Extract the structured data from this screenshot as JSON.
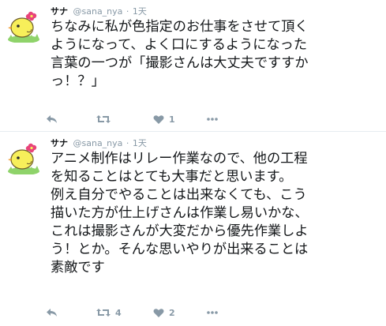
{
  "tweets": [
    {
      "name": "サナ",
      "handle": "@sana_nya",
      "separator": "·",
      "time": "1天",
      "lines": [
        "ちなみに私が色指定のお仕事をさせて頂く",
        "ようになって、よく口にするようになった",
        "言葉の一つが「撮影さんは大丈夫ですすか",
        "っ！？」"
      ],
      "retweets": "",
      "likes": "1"
    },
    {
      "name": "サナ",
      "handle": "@sana_nya",
      "separator": "·",
      "time": "1天",
      "lines": [
        "アニメ制作はリレー作業なので、他の工程",
        "を知ることはとても大事だと思います。",
        "例え自分でやることは出来なくても、こう",
        "描いた方が仕上げさんは作業し易いかな、",
        "これは撮影さんが大変だから優先作業しよ",
        "う！とか。そんな思いやりが出来ることは",
        "素敵です"
      ],
      "retweets": "4",
      "likes": "2"
    }
  ],
  "icons": {
    "reply": "reply-icon",
    "retweet": "retweet-icon",
    "like": "heart-icon",
    "more": "more-icon"
  },
  "colors": {
    "action_gray": "#8899a6",
    "text": "#14171a",
    "avatar_chick": "#f7ef5a",
    "avatar_flower": "#e8437a",
    "avatar_grass": "#8fd36a"
  }
}
